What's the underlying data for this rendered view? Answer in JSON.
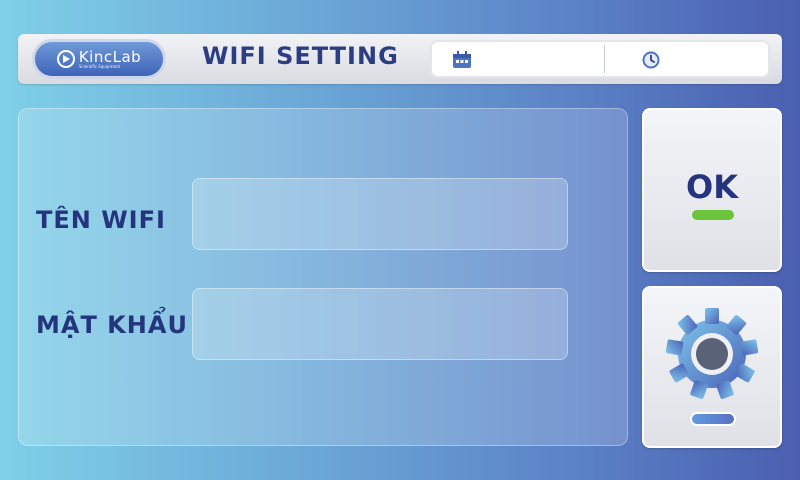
{
  "header": {
    "logo_name": "KincLab",
    "logo_tagline": "Scientific Equipment",
    "title": "WIFI SETTING",
    "date": "",
    "time": ""
  },
  "form": {
    "ssid_label": "TÊN WIFI",
    "ssid_value": "",
    "password_label": "MẬT KHẨU",
    "password_value": ""
  },
  "actions": {
    "ok_label": "OK"
  },
  "colors": {
    "ok_indicator": "#6cc33c",
    "title_text": "#2c3e82"
  },
  "icons": {
    "calendar": "calendar-icon",
    "clock": "clock-icon",
    "settings": "gear-icon"
  }
}
